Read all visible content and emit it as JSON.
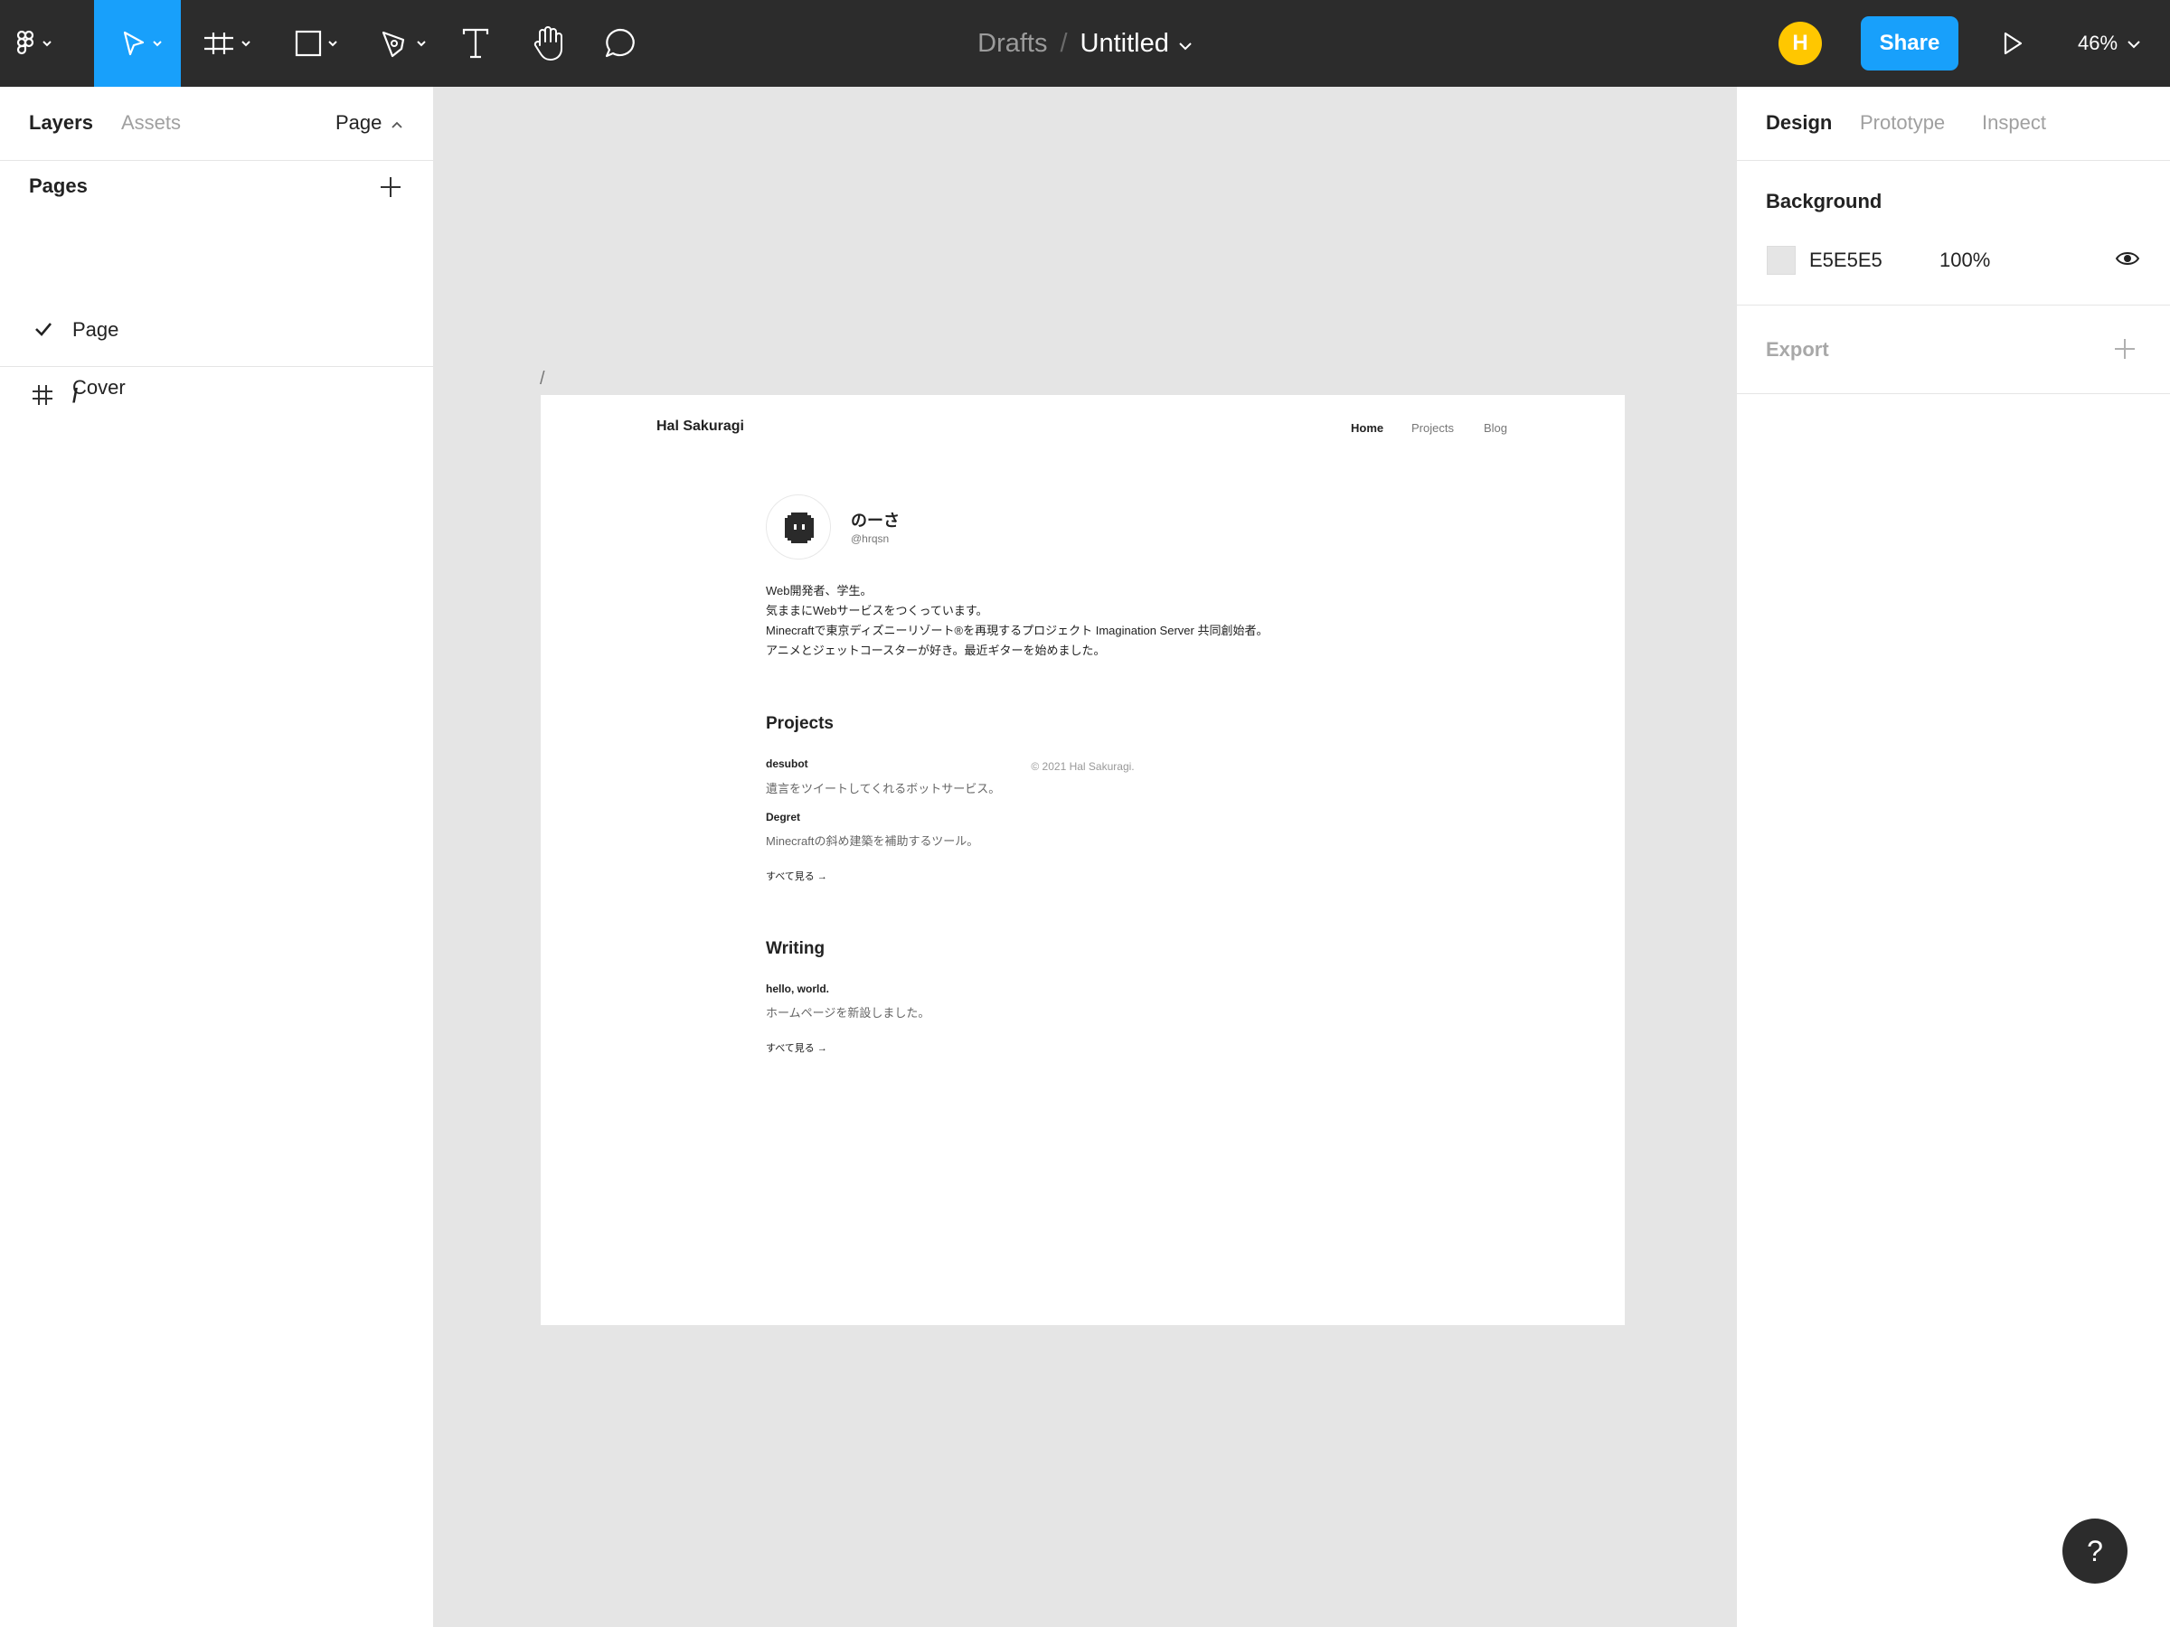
{
  "toolbar": {
    "tools": [
      "main-menu",
      "move",
      "frame",
      "shape",
      "pen",
      "text",
      "hand",
      "comment"
    ],
    "breadcrumb": {
      "folder": "Drafts",
      "separator": "/",
      "file": "Untitled"
    },
    "avatar_initial": "H",
    "avatar_color": "#ffc700",
    "share_label": "Share",
    "zoom": "46%",
    "accent": "#18a0fb"
  },
  "left_panel": {
    "tabs": {
      "layers": "Layers",
      "assets": "Assets"
    },
    "page_selector": "Page",
    "pages_title": "Pages",
    "pages": [
      {
        "label": "Page",
        "selected": true
      },
      {
        "label": "Cover",
        "selected": false
      }
    ],
    "layers": [
      {
        "icon": "frame-icon",
        "label": "/"
      }
    ]
  },
  "right_panel": {
    "tabs": {
      "design": "Design",
      "prototype": "Prototype",
      "inspect": "Inspect"
    },
    "background_title": "Background",
    "background_hex": "E5E5E5",
    "background_opacity": "100%",
    "export_title": "Export"
  },
  "canvas": {
    "frame_label": "/",
    "background": "#e5e5e5",
    "site": {
      "name": "Hal Sakuragi",
      "nav": {
        "home": "Home",
        "projects": "Projects",
        "blog": "Blog"
      },
      "profile": {
        "name": "のーさ",
        "handle": "@hrqsn"
      },
      "bio": [
        "Web開発者、学生。",
        "気ままにWebサービスをつくっています。",
        "Minecraftで東京ディズニーリゾート®を再現するプロジェクト Imagination Server 共同創始者。",
        "アニメとジェットコースターが好き。最近ギターを始めました。"
      ],
      "projects_title": "Projects",
      "projects": [
        {
          "title": "desubot",
          "desc": "遺言をツイートしてくれるボットサービス。"
        },
        {
          "title": "Degret",
          "desc": "Minecraftの斜め建築を補助するツール。"
        }
      ],
      "projects_see_all": "すべて見る →",
      "writing_title": "Writing",
      "writing": [
        {
          "title": "hello, world.",
          "desc": "ホームページを新設しました。"
        }
      ],
      "writing_see_all": "すべて見る →",
      "footer": "© 2021 Hal Sakuragi."
    }
  },
  "help_label": "?"
}
